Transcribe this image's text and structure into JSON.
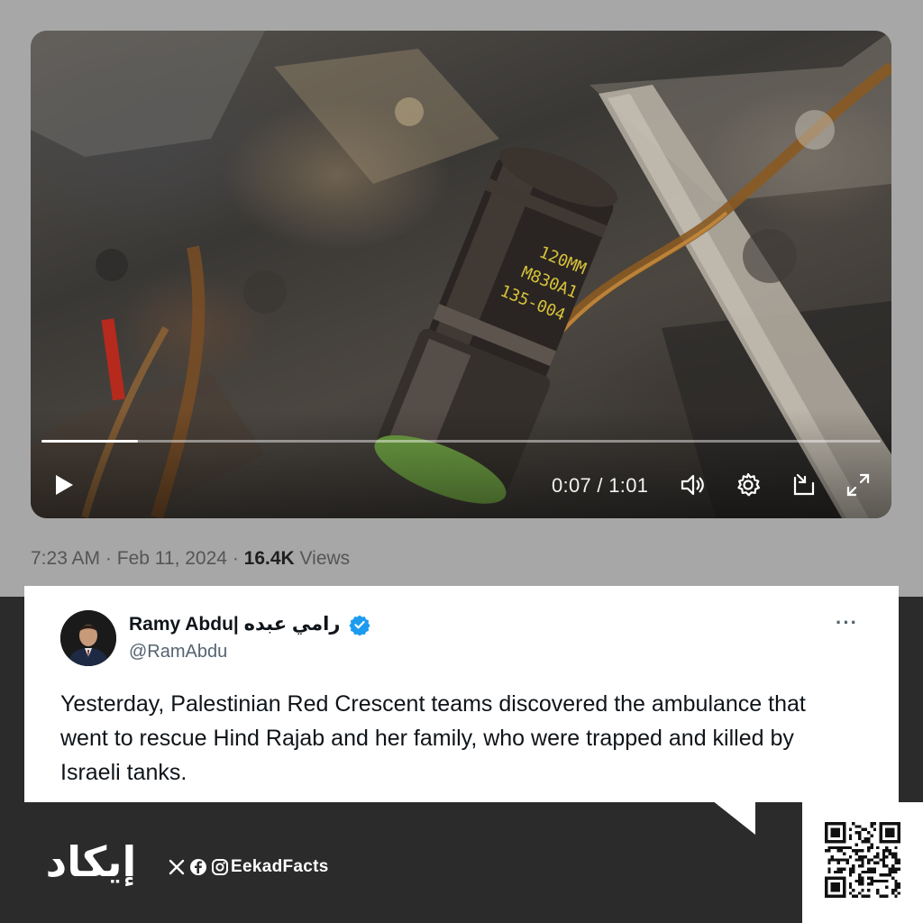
{
  "video": {
    "time_label": "0:07 / 1:01",
    "progress": 0.115
  },
  "tweet_meta": {
    "time": "7:23 AM",
    "separator": "·",
    "date": "Feb 11, 2024",
    "views_count": "16.4K",
    "views_label": "Views"
  },
  "tweet": {
    "display_name": "Ramy Abdu| رامي عبده",
    "handle": "@RamAbdu",
    "more_label": "···",
    "text": "Yesterday, Palestinian Red Crescent teams discovered the ambulance that went to rescue Hind Rajab and her family, who were trapped and killed by Israeli tanks."
  },
  "footer": {
    "logo_text": "إيكاد",
    "brand": "EekadFacts",
    "social_icons": [
      "x-icon",
      "facebook-icon",
      "instagram-icon"
    ]
  },
  "colors": {
    "top_background": "#a7a7a7",
    "bottom_background": "#2b2b2b",
    "verified_blue": "#1d9bf0",
    "logo_accent": "#ffffff"
  }
}
